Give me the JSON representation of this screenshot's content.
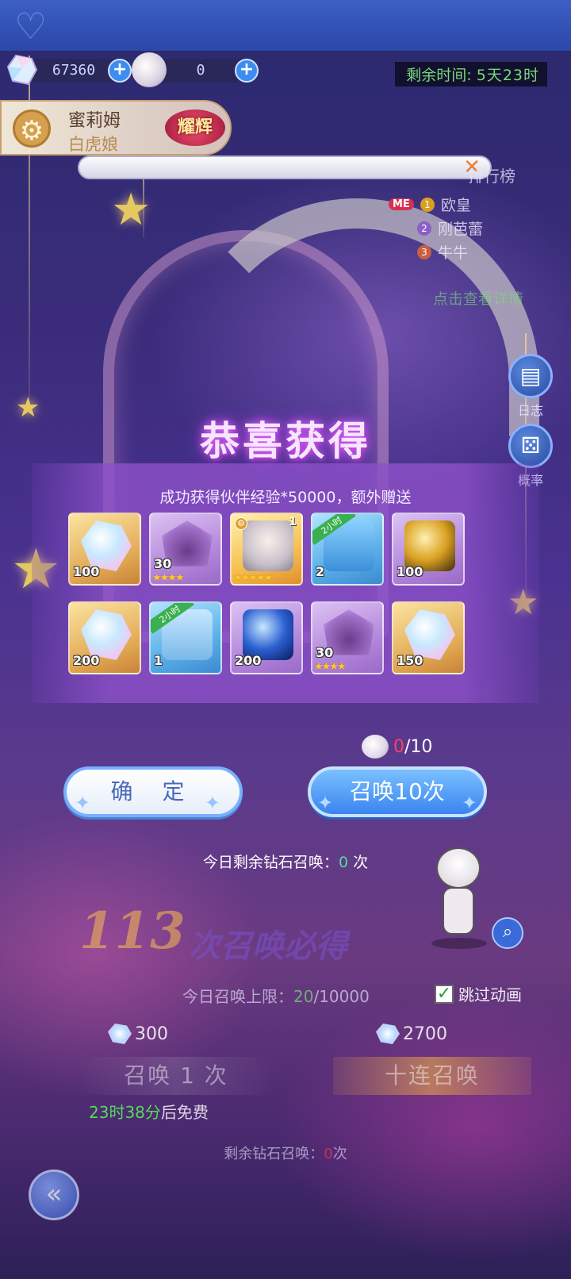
{
  "resources": {
    "diamonds": "67360",
    "pearls": "0",
    "plus_symbol": "+"
  },
  "timer": {
    "label": "剩余时间:",
    "value": "5天23时"
  },
  "hero": {
    "name": "蜜莉姆",
    "subtitle": "白虎娘",
    "badge": "耀辉"
  },
  "notice": {
    "close_symbol": "✕"
  },
  "ranking": {
    "title": "排行榜",
    "me_badge": "ME",
    "entries": [
      {
        "rank": "1",
        "name": "欧皇"
      },
      {
        "rank": "2",
        "name": "刚芭蕾"
      },
      {
        "rank": "3",
        "name": "牛牛"
      }
    ],
    "detail_link": "点击查看详情"
  },
  "side_buttons": {
    "log": "日志",
    "probability": "概率"
  },
  "popup": {
    "title": "恭喜获得",
    "message": "成功获得伙伴经验*50000，额外赠送",
    "rewards": [
      {
        "icon": "crystal-icon",
        "qty": "100",
        "frame": "gold"
      },
      {
        "icon": "shard-icon",
        "qty": "30",
        "frame": "purple",
        "stars": "★★★★"
      },
      {
        "icon": "portrait-icon",
        "qty": "",
        "frame": "orange",
        "level": "1",
        "stars": "★★★★★"
      },
      {
        "icon": "chest-icon",
        "qty": "2",
        "frame": "blue",
        "tag": "2小时"
      },
      {
        "icon": "egg-icon",
        "qty": "100",
        "frame": "purple"
      },
      {
        "icon": "crystal-icon",
        "qty": "200",
        "frame": "gold"
      },
      {
        "icon": "chest-icon",
        "qty": "1",
        "frame": "blue",
        "tag": "2小时"
      },
      {
        "icon": "orb-icon",
        "qty": "200",
        "frame": "purple"
      },
      {
        "icon": "shard-icon",
        "qty": "30",
        "frame": "purple",
        "stars": "★★★★"
      },
      {
        "icon": "crystal-icon",
        "qty": "150",
        "frame": "gold"
      }
    ],
    "pearl_have": "0",
    "pearl_need": "/10",
    "confirm_label": "确 定",
    "summon10_label": "召唤10次",
    "daily_diamond_prefix": "今日剩余钻石召唤：",
    "daily_diamond_count": "0",
    "daily_diamond_suffix": " 次"
  },
  "summon_screen": {
    "pity_number": "113",
    "pity_text": "次召唤必得",
    "limit_label": "今日召唤上限：",
    "limit_used": "20",
    "limit_total": "/10000",
    "skip_label": "跳过动画",
    "skip_checked": true,
    "cost_single": "300",
    "cost_ten": "2700",
    "summon1_label": "召唤 1 次",
    "summon10_label": "十连召唤",
    "free_time": "23时38分",
    "free_suffix": "后免费",
    "remain_label": "剩余钻石召唤：",
    "remain_count": "0",
    "remain_suffix": "次"
  },
  "colors": {
    "accent_blue": "#3a84f0",
    "timer_green": "#7ad87a",
    "alert_red": "#ff4060"
  }
}
